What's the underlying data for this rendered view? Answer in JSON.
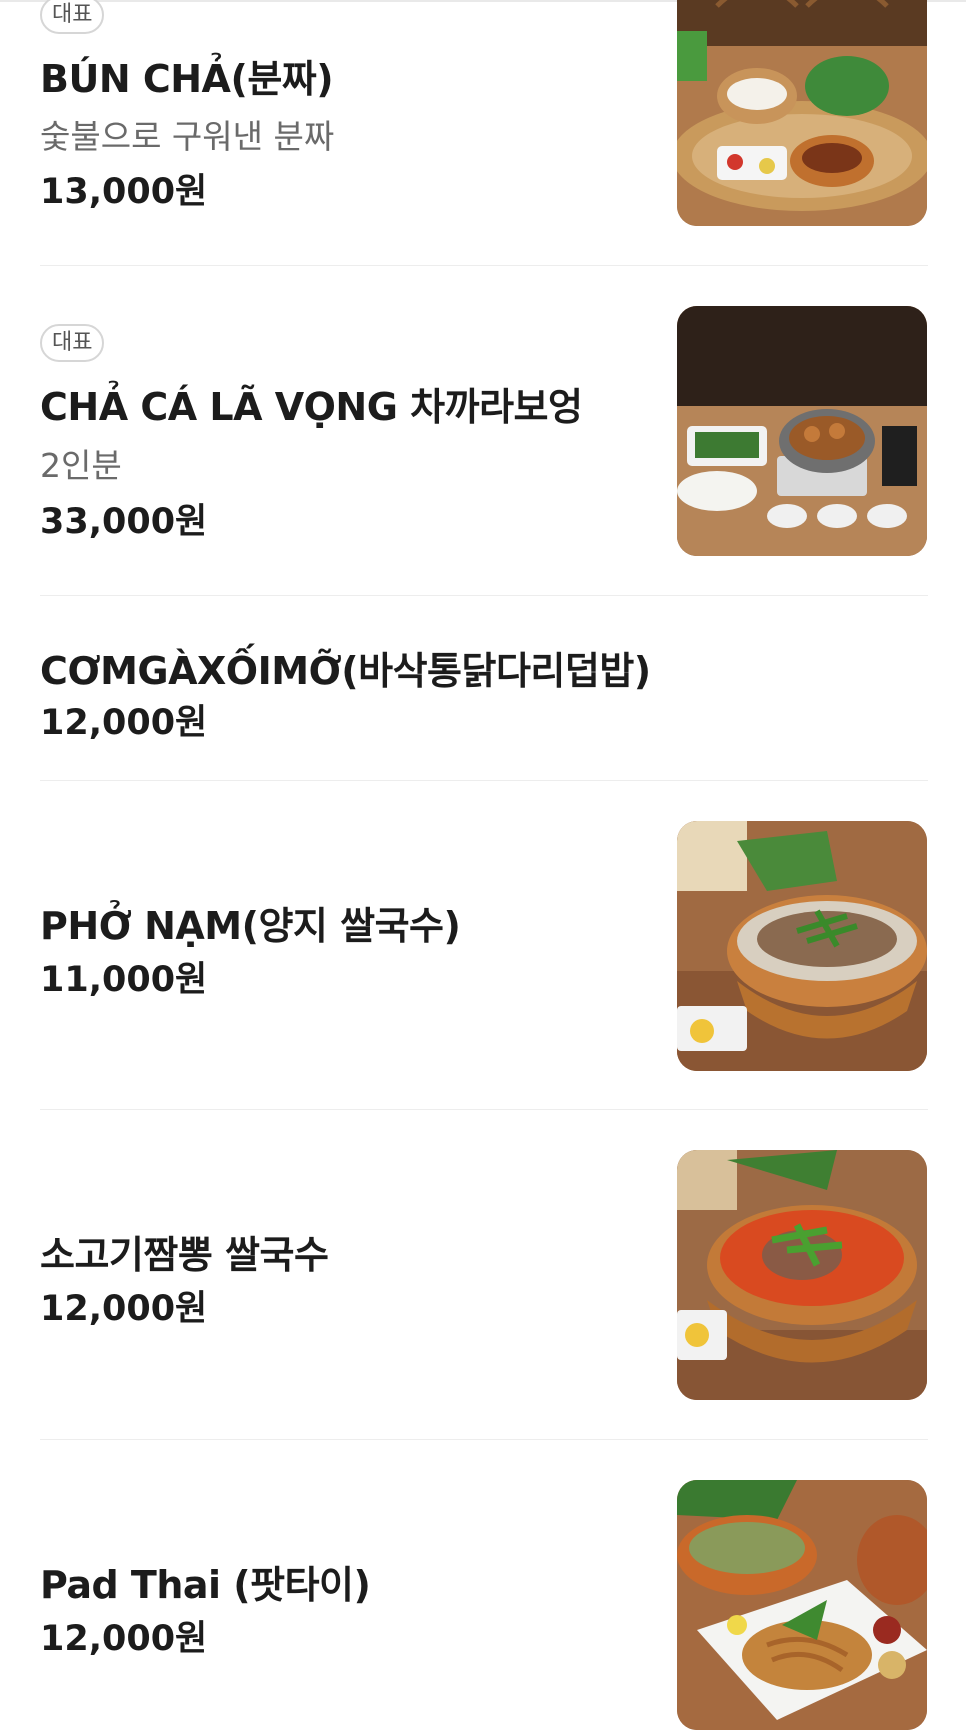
{
  "menu": {
    "items": [
      {
        "badge": "대표",
        "name": "BÚN CHẢ(분짜)",
        "desc": "숯불으로 구워낸 분짜",
        "price": "13,000원",
        "image": "bun-cha-photo"
      },
      {
        "badge": "대표",
        "name": "CHẢ CÁ LÃ VỌNG 차까라보엉",
        "desc": "2인분",
        "price": "33,000원",
        "image": "cha-ca-photo"
      },
      {
        "name": "CƠMGÀXỐIMỠ(바삭통닭다리덥밥)",
        "price": "12,000원"
      },
      {
        "name": "PHỞ NẠM(양지 쌀국수)",
        "price": "11,000원",
        "image": "pho-nam-photo"
      },
      {
        "name": "소고기짬뽕 쌀국수",
        "price": "12,000원",
        "image": "beef-jjamppong-pho-photo"
      },
      {
        "name": "Pad Thai (팟타이)",
        "price": "12,000원",
        "image": "pad-thai-photo"
      }
    ]
  },
  "colors": {
    "text": "#1c1c1c",
    "muted": "#6a6a6a",
    "divider": "#ededed",
    "badge_border": "#d6d6d6"
  }
}
